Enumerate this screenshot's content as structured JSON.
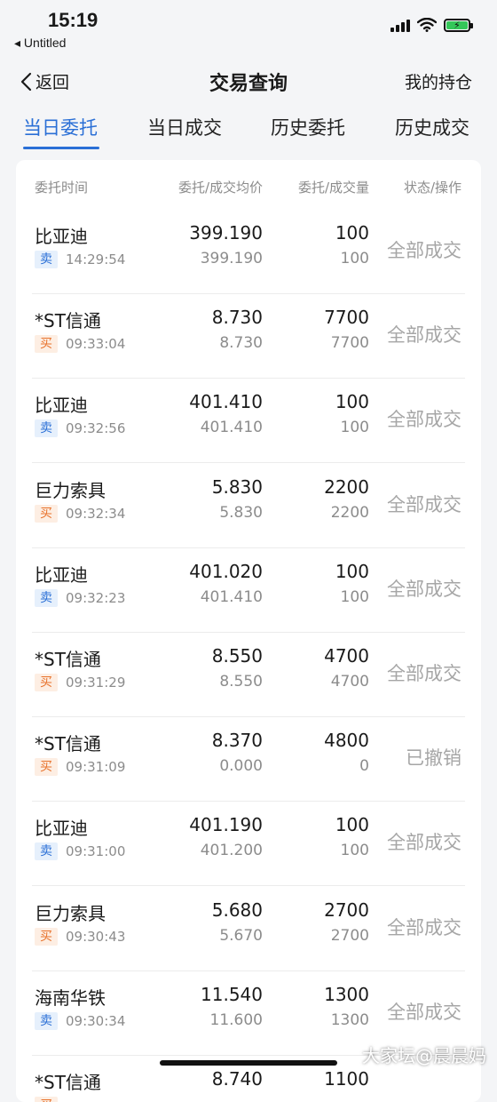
{
  "status_bar": {
    "time": "15:19",
    "back_app": "◂ Untitled"
  },
  "nav": {
    "back_label": "返回",
    "title": "交易查询",
    "right_label": "我的持仓"
  },
  "tabs": [
    {
      "label": "当日委托",
      "active": true
    },
    {
      "label": "当日成交"
    },
    {
      "label": "历史委托"
    },
    {
      "label": "历史成交"
    }
  ],
  "table": {
    "headers": {
      "time": "委托时间",
      "price": "委托/成交均价",
      "qty": "委托/成交量",
      "status": "状态/操作"
    },
    "rows": [
      {
        "name": "比亚迪",
        "side": "卖",
        "time": "14:29:54",
        "order_price": "399.190",
        "avg_price": "399.190",
        "order_qty": "100",
        "filled_qty": "100",
        "status": "全部成交"
      },
      {
        "name": "*ST信通",
        "side": "买",
        "time": "09:33:04",
        "order_price": "8.730",
        "avg_price": "8.730",
        "order_qty": "7700",
        "filled_qty": "7700",
        "status": "全部成交"
      },
      {
        "name": "比亚迪",
        "side": "卖",
        "time": "09:32:56",
        "order_price": "401.410",
        "avg_price": "401.410",
        "order_qty": "100",
        "filled_qty": "100",
        "status": "全部成交"
      },
      {
        "name": "巨力索具",
        "side": "买",
        "time": "09:32:34",
        "order_price": "5.830",
        "avg_price": "5.830",
        "order_qty": "2200",
        "filled_qty": "2200",
        "status": "全部成交"
      },
      {
        "name": "比亚迪",
        "side": "卖",
        "time": "09:32:23",
        "order_price": "401.020",
        "avg_price": "401.410",
        "order_qty": "100",
        "filled_qty": "100",
        "status": "全部成交"
      },
      {
        "name": "*ST信通",
        "side": "买",
        "time": "09:31:29",
        "order_price": "8.550",
        "avg_price": "8.550",
        "order_qty": "4700",
        "filled_qty": "4700",
        "status": "全部成交"
      },
      {
        "name": "*ST信通",
        "side": "买",
        "time": "09:31:09",
        "order_price": "8.370",
        "avg_price": "0.000",
        "order_qty": "4800",
        "filled_qty": "0",
        "status": "已撤销"
      },
      {
        "name": "比亚迪",
        "side": "卖",
        "time": "09:31:00",
        "order_price": "401.190",
        "avg_price": "401.200",
        "order_qty": "100",
        "filled_qty": "100",
        "status": "全部成交"
      },
      {
        "name": "巨力索具",
        "side": "买",
        "time": "09:30:43",
        "order_price": "5.680",
        "avg_price": "5.670",
        "order_qty": "2700",
        "filled_qty": "2700",
        "status": "全部成交"
      },
      {
        "name": "海南华铁",
        "side": "卖",
        "time": "09:30:34",
        "order_price": "11.540",
        "avg_price": "11.600",
        "order_qty": "1300",
        "filled_qty": "1300",
        "status": "全部成交"
      },
      {
        "name": "*ST信通",
        "side": "买",
        "time": "",
        "order_price": "8.740",
        "avg_price": "",
        "order_qty": "1100",
        "filled_qty": "",
        "status": ""
      }
    ]
  },
  "watermark": "大家坛@晨晨妈",
  "colors": {
    "accent": "#2a6fd6",
    "sell": "#2a6fd6",
    "buy": "#e8732d",
    "battery": "#34c759"
  }
}
